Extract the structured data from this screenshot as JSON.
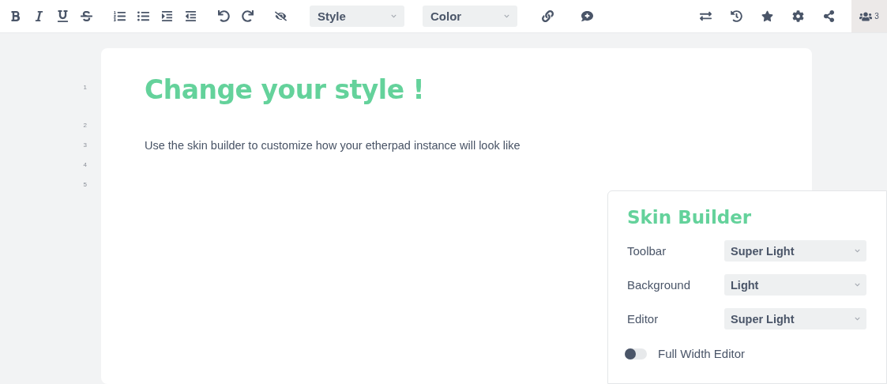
{
  "toolbar": {
    "left_groups": [
      [
        {
          "kind": "bold"
        },
        {
          "kind": "italic"
        },
        {
          "kind": "underline"
        },
        {
          "kind": "strikethrough"
        }
      ],
      [
        {
          "kind": "ordered-list"
        },
        {
          "kind": "bullet-list"
        },
        {
          "kind": "indent"
        },
        {
          "kind": "outdent"
        }
      ],
      [
        {
          "kind": "undo"
        },
        {
          "kind": "redo"
        }
      ],
      [
        {
          "kind": "hide-colors"
        }
      ]
    ],
    "dropdowns": [
      {
        "label": "Style"
      },
      {
        "label": "Color"
      }
    ],
    "middle_buttons": [
      {
        "kind": "link"
      },
      {
        "kind": "add-comment"
      }
    ],
    "right_buttons": [
      {
        "kind": "import-export"
      },
      {
        "kind": "history"
      },
      {
        "kind": "star"
      },
      {
        "kind": "settings"
      },
      {
        "kind": "share"
      }
    ],
    "users": {
      "count": "3"
    }
  },
  "editor": {
    "lines": [
      {
        "number": "1",
        "kind": "heading",
        "text": "Change your style !"
      },
      {
        "number": "2",
        "kind": "empty"
      },
      {
        "number": "3",
        "kind": "paragraph",
        "text": "Use the skin builder to customize how your etherpad instance will look like"
      },
      {
        "number": "4",
        "kind": "empty"
      },
      {
        "number": "5",
        "kind": "empty"
      }
    ]
  },
  "skin_builder": {
    "title": "Skin Builder",
    "rows": [
      {
        "label": "Toolbar",
        "value": "Super Light"
      },
      {
        "label": "Background",
        "value": "Light"
      },
      {
        "label": "Editor",
        "value": "Super Light"
      }
    ],
    "toggle": {
      "label": "Full Width Editor",
      "on": false
    }
  }
}
